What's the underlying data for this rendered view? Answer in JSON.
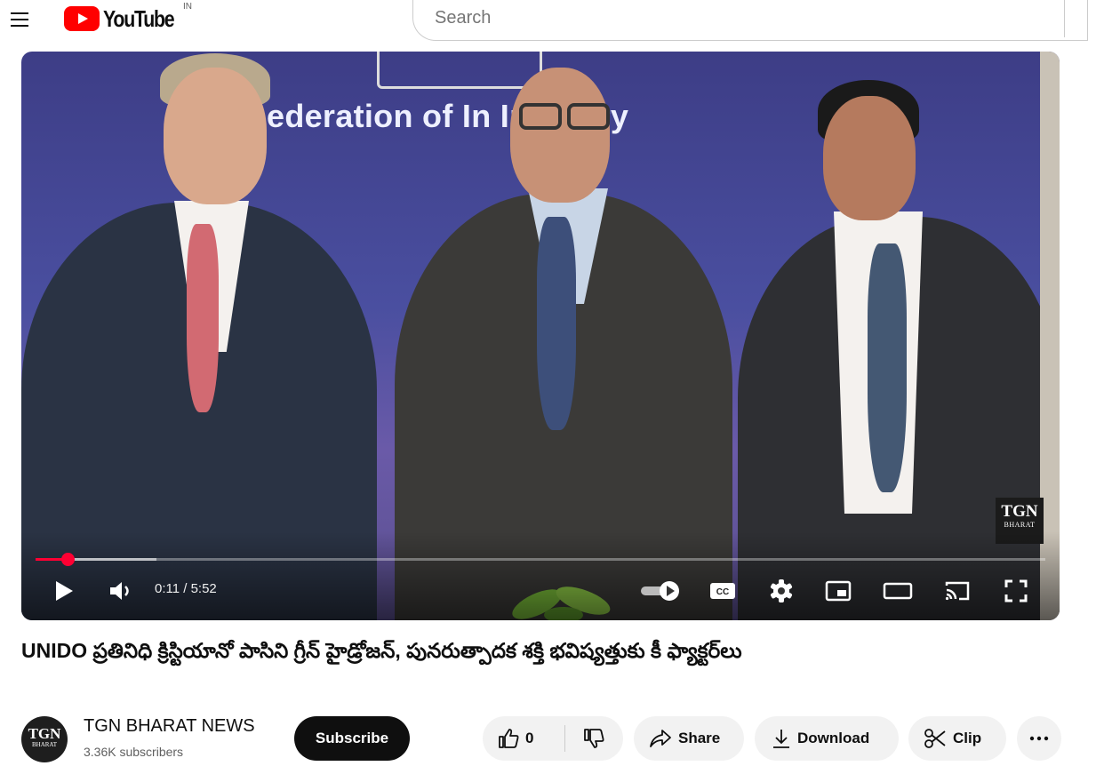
{
  "header": {
    "logo_text": "YouTube",
    "country_code": "IN",
    "search_placeholder": "Search"
  },
  "video": {
    "banner_text": "ederation of In     Industry",
    "watermark_line1": "TGN",
    "watermark_line2": "BHARAT",
    "time_display": "0:11 / 5:52",
    "progress_played": 0.032,
    "progress_loaded": 0.12
  },
  "title": "UNIDO ప్రతినిధి క్రిస్టియానో పాసిని గ్రీన్ హైడ్రోజన్, పునరుత్పాదక శక్తి భవిష్యత్తుకు కీ ఫ్యాక్టర్‌లు",
  "channel": {
    "avatar_line1": "TGN",
    "avatar_line2": "BHARAT",
    "name": "TGN BHARAT NEWS",
    "subscribers": "3.36K subscribers",
    "subscribe_label": "Subscribe"
  },
  "actions": {
    "like_count": "0",
    "share_label": "Share",
    "download_label": "Download",
    "clip_label": "Clip"
  },
  "colors": {
    "accent_red": "#ff0033",
    "text_primary": "#0f0f0f",
    "text_secondary": "#606060",
    "pill_bg": "#f2f2f2"
  }
}
